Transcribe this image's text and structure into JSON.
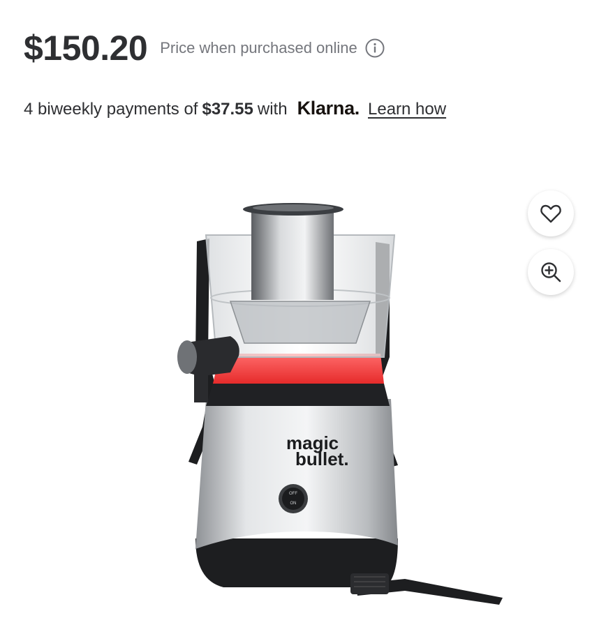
{
  "price": {
    "amount": "$150.20",
    "note": "Price when purchased online"
  },
  "klarna": {
    "prefix": "4 biweekly payments of",
    "amount": "$37.55",
    "with": "with",
    "brand": "Klarna.",
    "learn_link": "Learn how"
  },
  "product": {
    "brand_line1": "magic",
    "brand_line2": "bullet.",
    "switch_off": "OFF",
    "switch_on": "ON",
    "accent_color": "#f03a3a"
  },
  "icons": {
    "info": "info-icon",
    "favorite": "heart-icon",
    "zoom": "zoom-in-icon"
  }
}
